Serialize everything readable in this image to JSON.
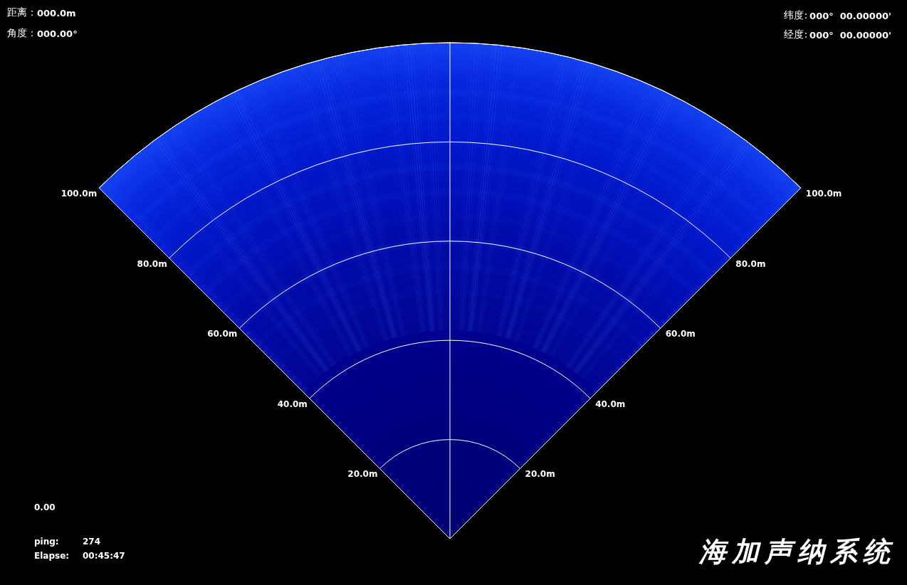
{
  "cursor_readout": [
    {
      "label": "距离：",
      "value": "000.0m"
    },
    {
      "label": "角度：",
      "value": "000.00°"
    }
  ],
  "position_readout": [
    {
      "label": "纬度:",
      "degrees": "000°",
      "minutes": "00.00000'"
    },
    {
      "label": "经度:",
      "degrees": "000°",
      "minutes": "00.00000'"
    }
  ],
  "sonar": {
    "range_rings": [
      {
        "left_label": "100.0m",
        "right_label": "100.0m"
      },
      {
        "left_label": "80.0m",
        "right_label": "80.0m"
      },
      {
        "left_label": "60.0m",
        "right_label": "60.0m"
      },
      {
        "left_label": "40.0m",
        "right_label": "40.0m"
      },
      {
        "left_label": "20.0m",
        "right_label": "20.0m"
      }
    ]
  },
  "reading": "0.00",
  "stats": [
    {
      "label": "ping:",
      "value": "274"
    },
    {
      "label": "Elapse:",
      "value": "00:45:47"
    }
  ],
  "title": "海加声纳系统"
}
